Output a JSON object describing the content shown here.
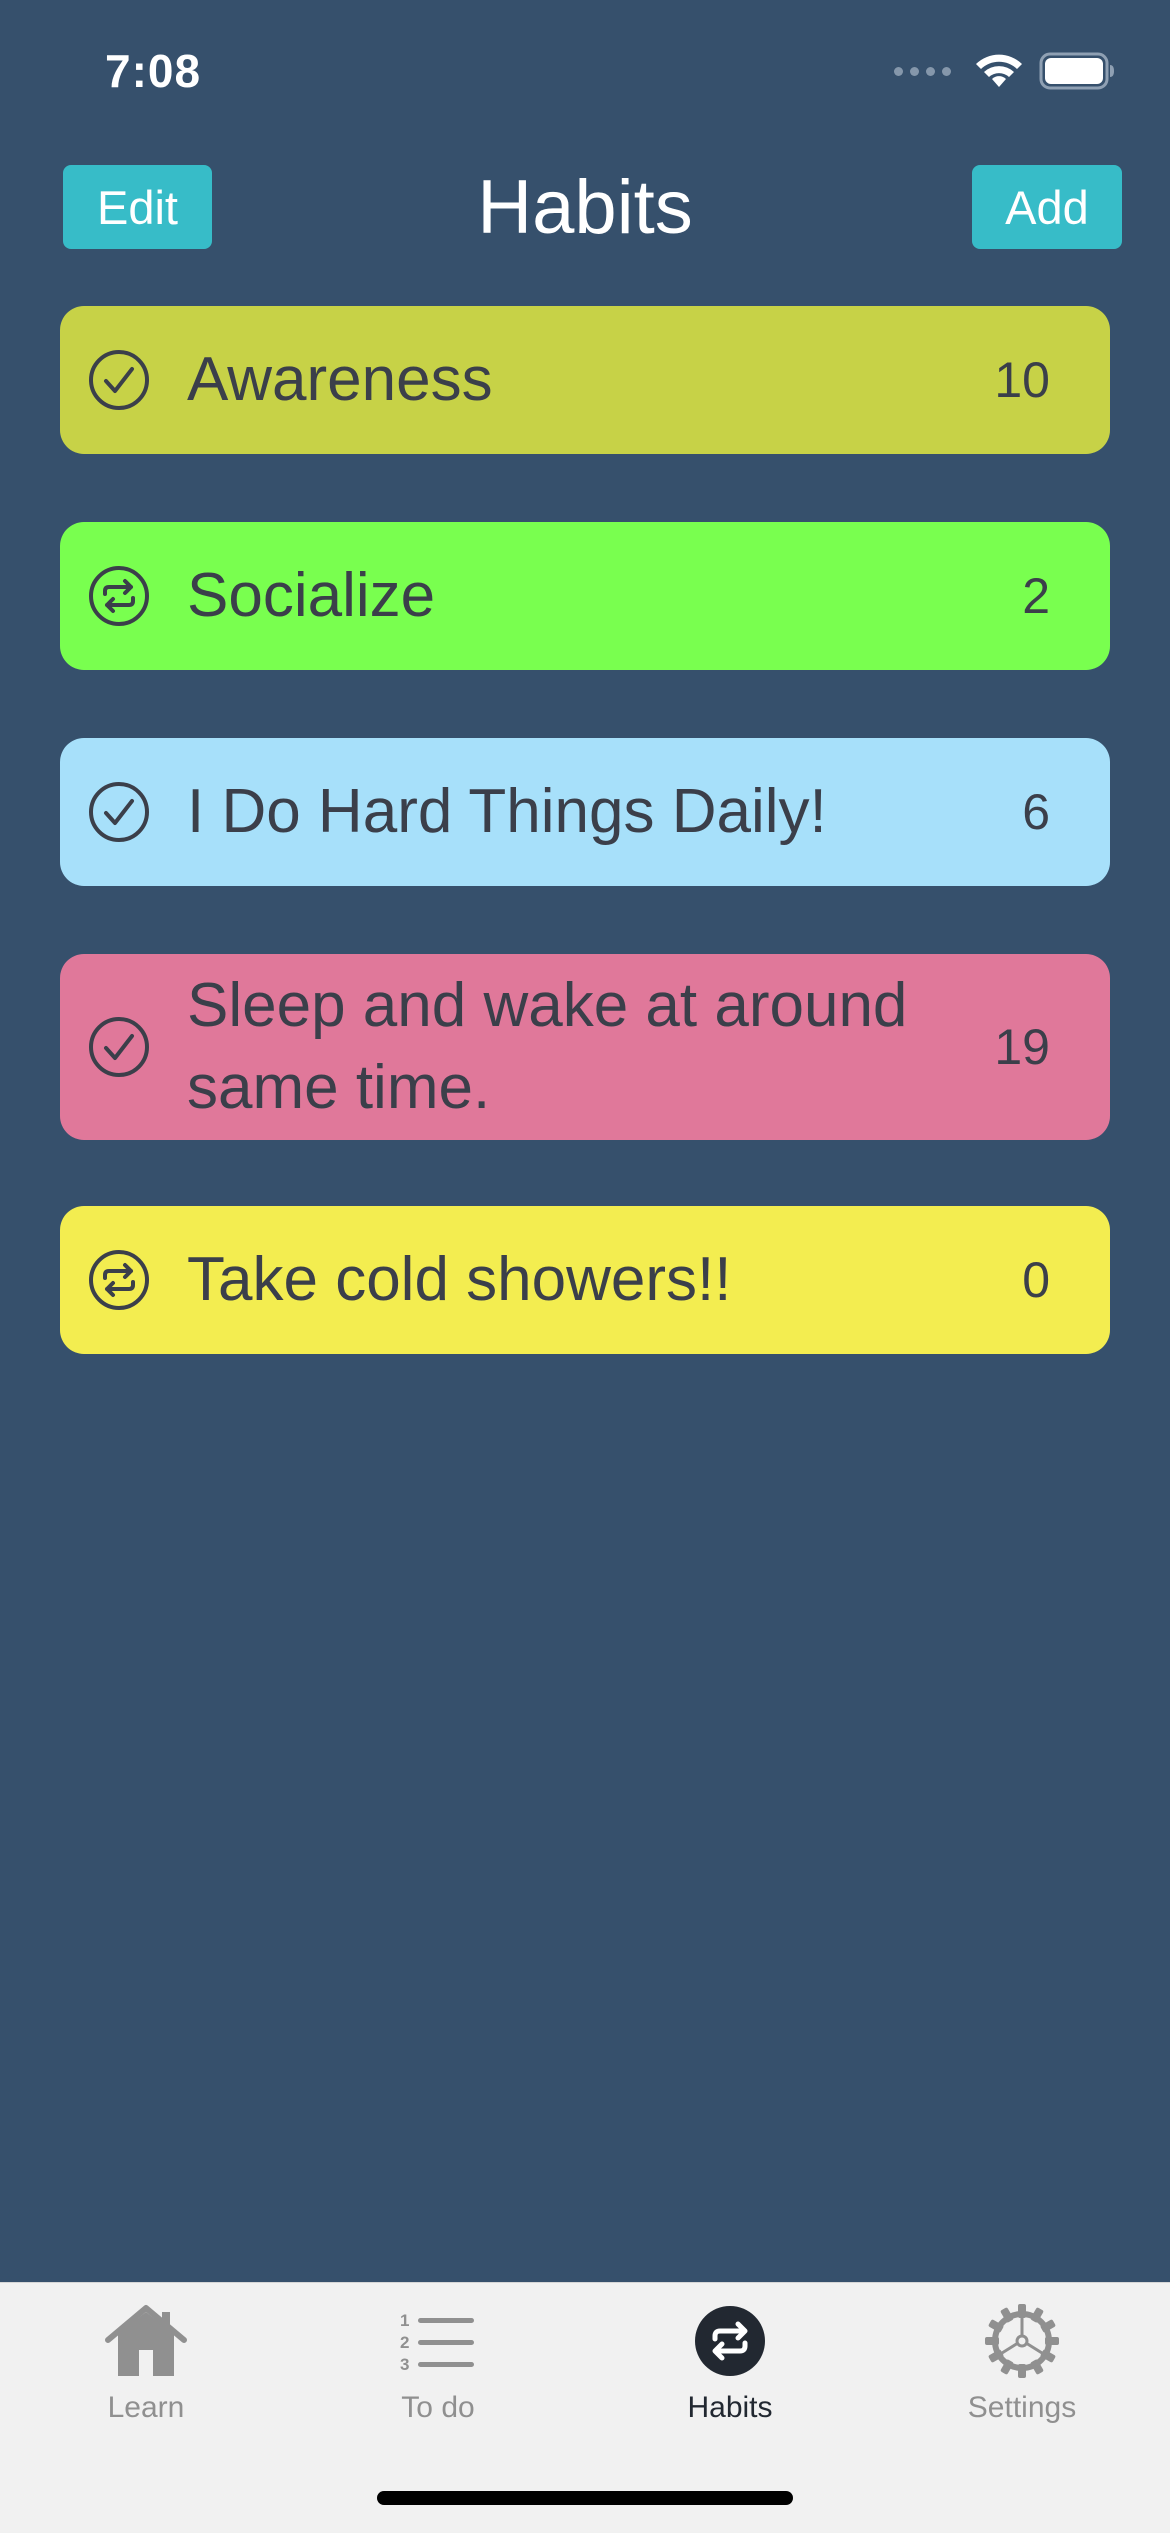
{
  "status_bar": {
    "time": "7:08"
  },
  "header": {
    "title": "Habits",
    "edit_label": "Edit",
    "add_label": "Add"
  },
  "colors": {
    "background": "#36506c",
    "button": "#37bcc8",
    "text_dark": "#3b3f4a",
    "tab_active": "#222831",
    "tab_inactive": "#909090"
  },
  "habits": [
    {
      "title": "Awareness",
      "count": "10",
      "icon": "check-circle-icon",
      "color": "#c7d247"
    },
    {
      "title": "Socialize",
      "count": "2",
      "icon": "repeat-circle-icon",
      "color": "#79ff4f"
    },
    {
      "title": "I Do Hard Things Daily!",
      "count": "6",
      "icon": "check-circle-icon",
      "color": "#a7e0fa"
    },
    {
      "title": "Sleep and wake at around same time.",
      "count": "19",
      "icon": "check-circle-icon",
      "color": "#e0789a"
    },
    {
      "title": "Take cold showers!!",
      "count": "0",
      "icon": "repeat-circle-icon",
      "color": "#f3ed50"
    }
  ],
  "tabs": [
    {
      "label": "Learn",
      "icon": "house-icon",
      "active": false
    },
    {
      "label": "To do",
      "icon": "numbered-list-icon",
      "active": false
    },
    {
      "label": "Habits",
      "icon": "repeat-circle-icon",
      "active": true
    },
    {
      "label": "Settings",
      "icon": "gear-icon",
      "active": false
    }
  ]
}
